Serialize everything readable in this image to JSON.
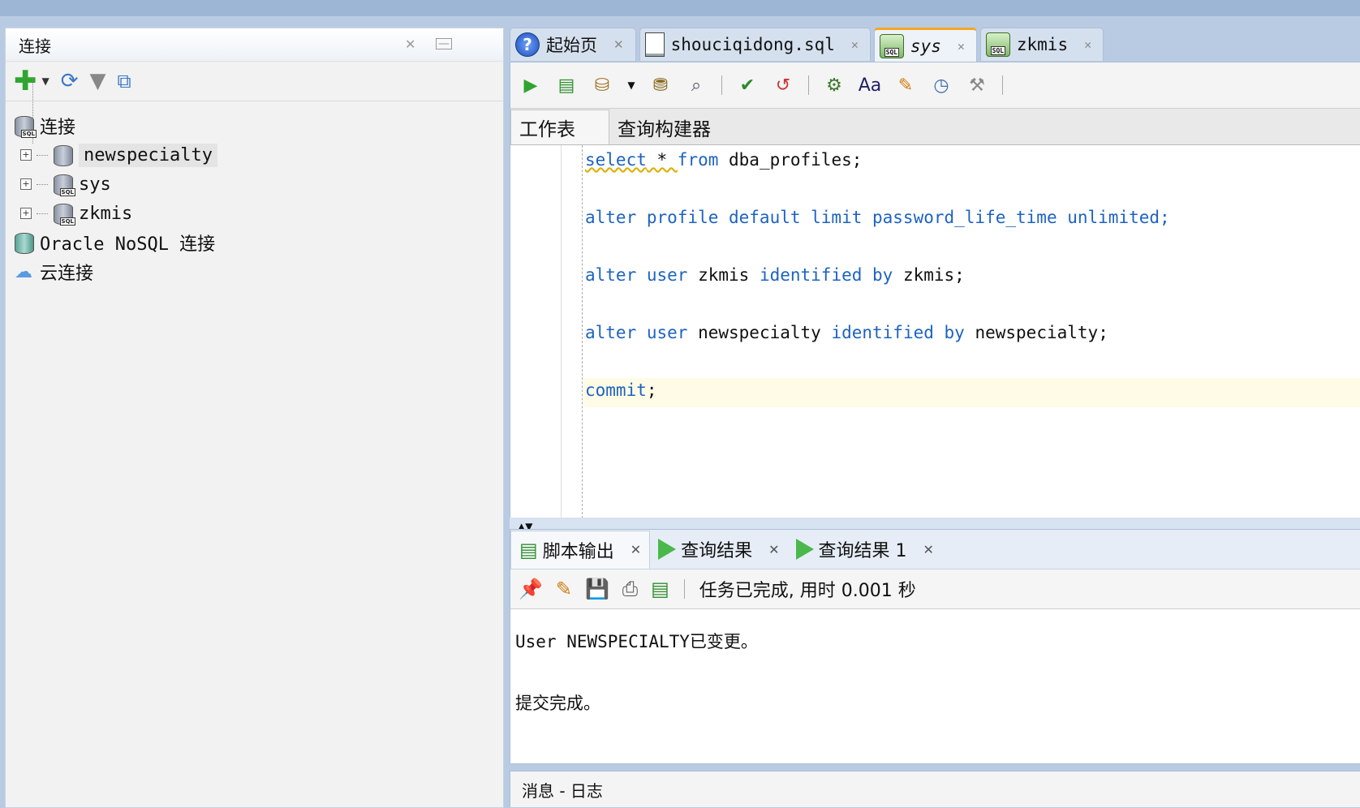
{
  "left_panel": {
    "title": "连接",
    "tree": {
      "root_label": "连接",
      "connections": [
        {
          "name": "newspecialty",
          "selected": true
        },
        {
          "name": "sys"
        },
        {
          "name": "zkmis"
        }
      ],
      "nosql_label": "Oracle NoSQL 连接",
      "cloud_label": "云连接"
    }
  },
  "doc_tabs": [
    {
      "label": "起始页"
    },
    {
      "label": "shouciqidong.sql"
    },
    {
      "label": "sys",
      "active": true
    },
    {
      "label": "zkmis"
    }
  ],
  "editor": {
    "sub_tabs": [
      "工作表",
      "查询构建器"
    ],
    "code": [
      {
        "kw1": "select",
        "rest1": " * ",
        "kw2": "from",
        "rest2": " dba_profiles;"
      },
      {
        "line": "alter profile default limit password_life_time unlimited;"
      },
      {
        "kw": "alter user",
        "name1": " zkmis ",
        "kw2": "identified by",
        "name2": " zkmis;"
      },
      {
        "kw": "alter user",
        "name1": " newspecialty ",
        "kw2": "identified by",
        "name2": " newspecialty;"
      },
      {
        "kw": "commit",
        "rest": ";"
      }
    ]
  },
  "results": {
    "tabs": [
      "脚本输出",
      "查询结果",
      "查询结果 1"
    ],
    "status": "任务已完成, 用时 0.001 秒",
    "output": [
      "User NEWSPECIALTY已变更。",
      "提交完成。"
    ]
  },
  "message_panel": {
    "title": "消息 - 日志"
  }
}
